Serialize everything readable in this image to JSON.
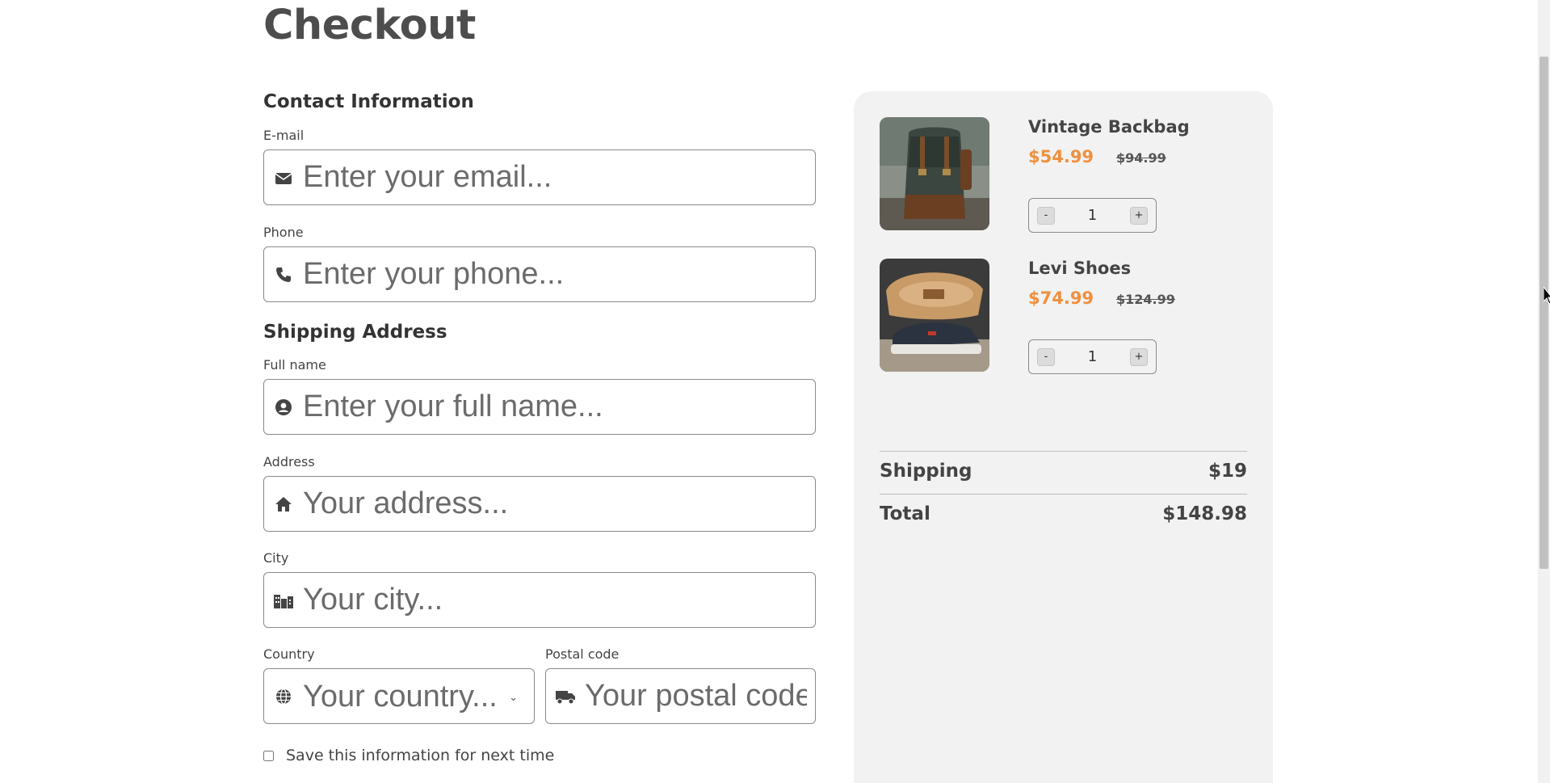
{
  "page": {
    "title": "Checkout"
  },
  "contact": {
    "section_title": "Contact Information",
    "email_label": "E-mail",
    "email_placeholder": "Enter your email...",
    "phone_label": "Phone",
    "phone_placeholder": "Enter your phone..."
  },
  "shipping": {
    "section_title": "Shipping Address",
    "fullname_label": "Full name",
    "fullname_placeholder": "Enter your full name...",
    "address_label": "Address",
    "address_placeholder": "Your address...",
    "city_label": "City",
    "city_placeholder": "Your city...",
    "country_label": "Country",
    "country_selected": "Your country...",
    "postal_label": "Postal code",
    "postal_placeholder": "Your postal code"
  },
  "save_info": {
    "label": "Save this information for next time",
    "checked": false
  },
  "cart": {
    "items": [
      {
        "name": "Vintage Backbag",
        "price": "$54.99",
        "old_price": "$94.99",
        "qty": "1",
        "minus": "-",
        "plus": "+"
      },
      {
        "name": "Levi Shoes",
        "price": "$74.99",
        "old_price": "$124.99",
        "qty": "1",
        "minus": "-",
        "plus": "+"
      }
    ],
    "shipping_label": "Shipping",
    "shipping_value": "$19",
    "total_label": "Total",
    "total_value": "$148.98"
  },
  "colors": {
    "accent": "#f0903f",
    "panel": "#f2f2f2",
    "text": "#4a4a4a"
  }
}
